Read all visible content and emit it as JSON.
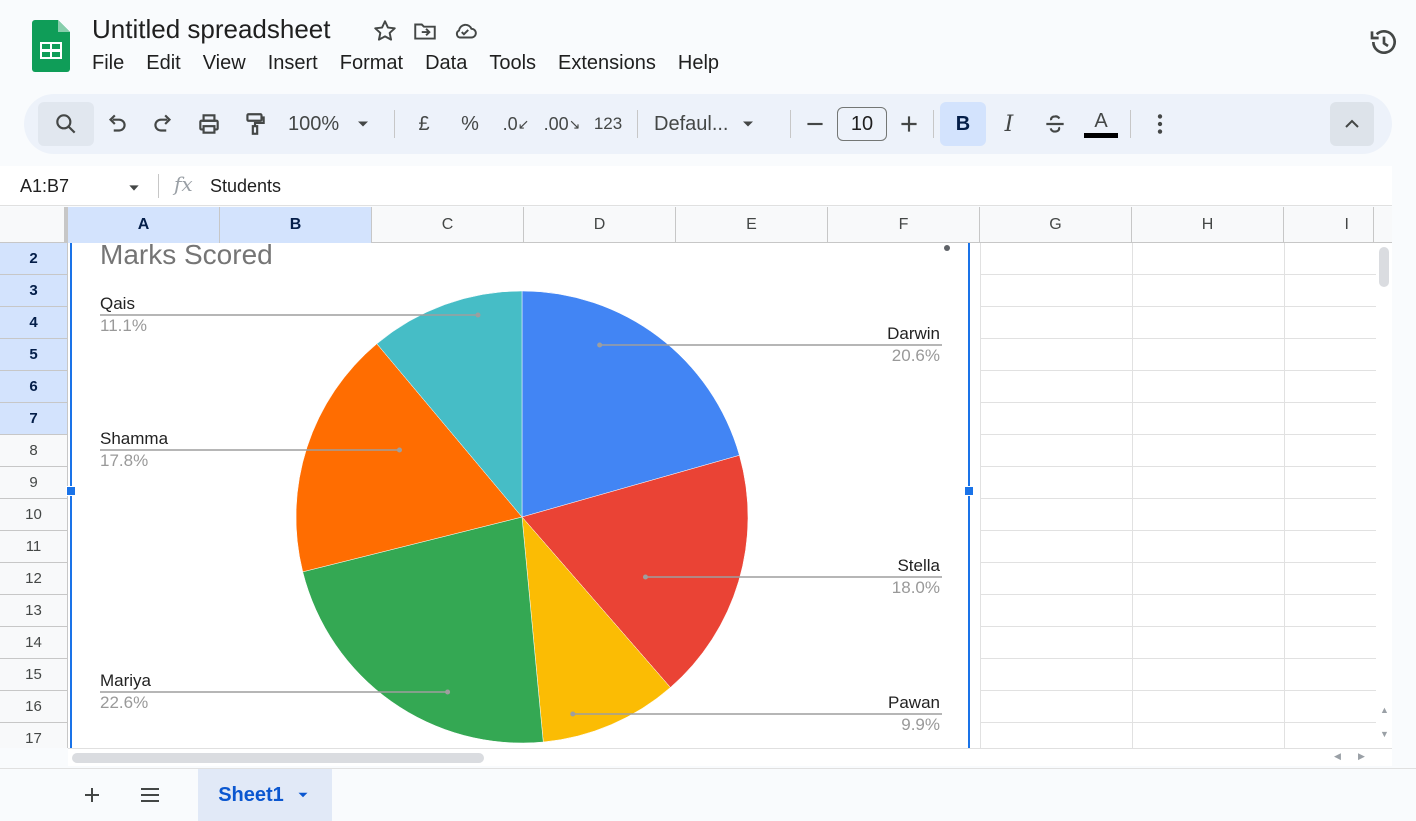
{
  "app": {
    "title": "Untitled spreadsheet",
    "menu": [
      "File",
      "Edit",
      "View",
      "Insert",
      "Format",
      "Data",
      "Tools",
      "Extensions",
      "Help"
    ]
  },
  "toolbar": {
    "zoom": "100%",
    "currency": "£",
    "percent": "%",
    "dec_decrease": ".0",
    "dec_increase": ".00",
    "number_format": "123",
    "font": "Defaul...",
    "font_size": "10",
    "bold": "B",
    "italic": "I",
    "text_color_glyph": "A"
  },
  "formula_bar": {
    "name_box": "A1:B7",
    "fx": "fx",
    "value": "Students"
  },
  "columns": [
    "A",
    "B",
    "C",
    "D",
    "E",
    "F",
    "G",
    "H",
    "I"
  ],
  "rows": [
    "2",
    "3",
    "4",
    "5",
    "6",
    "7",
    "8",
    "9",
    "10",
    "11",
    "12",
    "13",
    "14",
    "15",
    "16",
    "17"
  ],
  "selected_columns": [
    "A",
    "B"
  ],
  "selected_rows": [
    "2",
    "3",
    "4",
    "5",
    "6",
    "7"
  ],
  "chart_data": {
    "type": "pie",
    "title": "Marks Scored",
    "slices": [
      {
        "label": "Darwin",
        "pct": "20.6%",
        "value": 20.6,
        "color": "#4285f4"
      },
      {
        "label": "Stella",
        "pct": "18.0%",
        "value": 18.0,
        "color": "#ea4335"
      },
      {
        "label": "Pawan",
        "pct": "9.9%",
        "value": 9.9,
        "color": "#fbbc04"
      },
      {
        "label": "Mariya",
        "pct": "22.6%",
        "value": 22.6,
        "color": "#34a853"
      },
      {
        "label": "Shamma",
        "pct": "17.8%",
        "value": 17.8,
        "color": "#ff6d01"
      },
      {
        "label": "Qais",
        "pct": "11.1%",
        "value": 11.1,
        "color": "#46bdc6"
      }
    ]
  },
  "sheets": [
    {
      "name": "Sheet1",
      "active": true
    }
  ]
}
